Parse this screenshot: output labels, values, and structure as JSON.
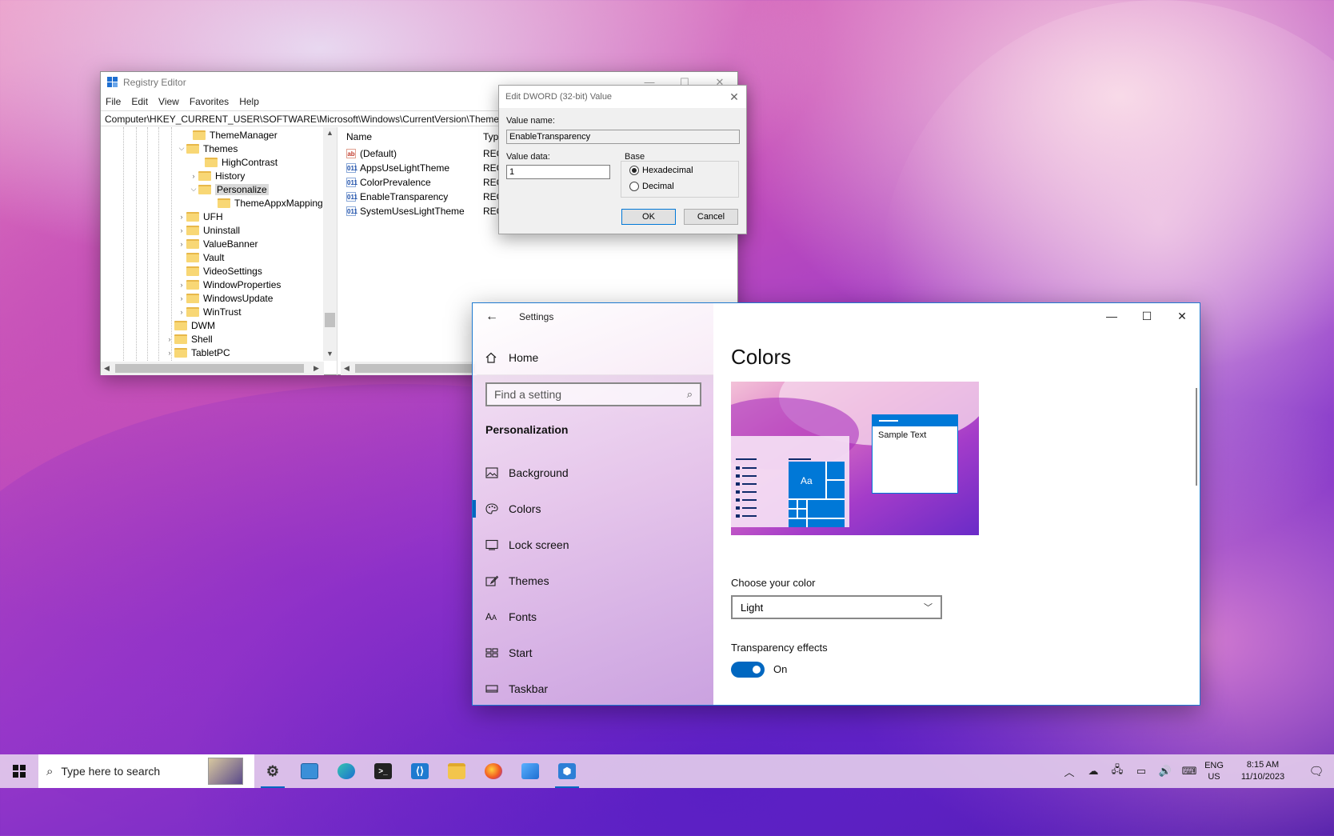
{
  "registry": {
    "title": "Registry Editor",
    "menu": [
      "File",
      "Edit",
      "View",
      "Favorites",
      "Help"
    ],
    "path": "Computer\\HKEY_CURRENT_USER\\SOFTWARE\\Microsoft\\Windows\\CurrentVersion\\Themes\\Personalize",
    "tree": [
      {
        "label": "ThemeManager"
      },
      {
        "label": "Themes"
      },
      {
        "label": "HighContrast"
      },
      {
        "label": "History"
      },
      {
        "label": "Personalize"
      },
      {
        "label": "ThemeAppxMapping"
      },
      {
        "label": "UFH"
      },
      {
        "label": "Uninstall"
      },
      {
        "label": "ValueBanner"
      },
      {
        "label": "Vault"
      },
      {
        "label": "VideoSettings"
      },
      {
        "label": "WindowProperties"
      },
      {
        "label": "WindowsUpdate"
      },
      {
        "label": "WinTrust"
      },
      {
        "label": "DWM"
      },
      {
        "label": "Shell"
      },
      {
        "label": "TabletPC"
      }
    ],
    "columns": {
      "name": "Name",
      "type": "Type"
    },
    "values": [
      {
        "name": "(Default)",
        "type": "REG",
        "icon": "ab"
      },
      {
        "name": "AppsUseLightTheme",
        "type": "REG",
        "icon": "011"
      },
      {
        "name": "ColorPrevalence",
        "type": "REG",
        "icon": "011"
      },
      {
        "name": "EnableTransparency",
        "type": "REG",
        "icon": "011"
      },
      {
        "name": "SystemUsesLightTheme",
        "type": "REG",
        "icon": "011"
      }
    ]
  },
  "dword_dialog": {
    "title": "Edit DWORD (32-bit) Value",
    "value_name_label": "Value name:",
    "value_name": "EnableTransparency",
    "value_data_label": "Value data:",
    "value_data": "1",
    "base_label": "Base",
    "hex_label": "Hexadecimal",
    "dec_label": "Decimal",
    "ok_label": "OK",
    "cancel_label": "Cancel"
  },
  "settings": {
    "app_title": "Settings",
    "home_label": "Home",
    "search_placeholder": "Find a setting",
    "section_title": "Personalization",
    "nav": [
      {
        "label": "Background",
        "icon": "image-icon"
      },
      {
        "label": "Colors",
        "icon": "palette-icon",
        "selected": true
      },
      {
        "label": "Lock screen",
        "icon": "lock-screen-icon"
      },
      {
        "label": "Themes",
        "icon": "brush-icon"
      },
      {
        "label": "Fonts",
        "icon": "font-icon"
      },
      {
        "label": "Start",
        "icon": "start-icon"
      },
      {
        "label": "Taskbar",
        "icon": "taskbar-icon"
      }
    ],
    "page_title": "Colors",
    "sample_text": "Sample Text",
    "tile_text": "Aa",
    "choose_color_label": "Choose your color",
    "color_value": "Light",
    "transparency_label": "Transparency effects",
    "transparency_state": "On",
    "accent": "#0067c0"
  },
  "taskbar": {
    "search_placeholder": "Type here to search",
    "apps": [
      "settings-icon",
      "control-panel-icon",
      "edge-icon",
      "terminal-icon",
      "vscode-icon",
      "file-explorer-icon",
      "firefox-icon",
      "photos-icon",
      "regedit-icon"
    ],
    "lang_line1": "ENG",
    "lang_line2": "US",
    "time": "8:15 AM",
    "date": "11/10/2023"
  }
}
